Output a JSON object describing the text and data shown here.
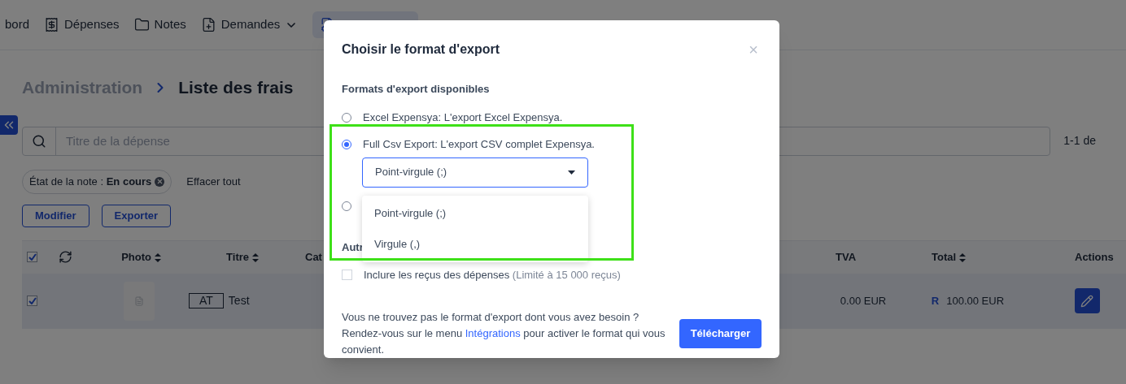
{
  "nav": {
    "items": [
      {
        "label": "bord",
        "kind": "plain",
        "selected": false
      },
      {
        "label": "Dépenses",
        "kind": "expenses",
        "selected": false
      },
      {
        "label": "Notes",
        "kind": "reports",
        "selected": false
      },
      {
        "label": "Demandes",
        "kind": "requests",
        "selected": false,
        "dropdown": true
      },
      {
        "kind": "admin",
        "selected": true
      }
    ]
  },
  "breadcrumb": {
    "parent": "Administration",
    "current": "Liste des frais"
  },
  "search": {
    "placeholder": "Titre de la dépense"
  },
  "pagination": "1-1 de",
  "filters": [
    {
      "label": "État de la note : ",
      "value": "En cours"
    }
  ],
  "clear_all": "Effacer tout",
  "actions": [
    "Modifier",
    "Exporter"
  ],
  "table": {
    "header_checked": true,
    "columns": [
      "Photo",
      "Titre",
      "Cat",
      "TVA",
      "Total",
      "Actions"
    ],
    "rows": [
      {
        "checked": true,
        "selected": true,
        "tag": "AT",
        "title": "Test",
        "tva": "0.00 EUR",
        "total_mark": "R",
        "total": "100.00 EUR"
      }
    ]
  },
  "dialog": {
    "title": "Choisir le format d'export",
    "close": "×",
    "section": "Formats d'export disponibles",
    "formats": [
      {
        "label": "Excel Expensya: L'export Excel Expensya.",
        "selected": false
      },
      {
        "label": "Full Csv Export: L'export CSV complet Expensya.",
        "selected": true,
        "separator": {
          "value": "Point-virgule (;)",
          "expanded": true,
          "options": [
            "Point-virgule (;)",
            "Virgule (,)"
          ]
        }
      },
      {
        "selected": false
      }
    ],
    "other_section": "Autr",
    "include_receipts": {
      "label": "Inclure les reçus des dépenses",
      "note": "(Limité à 15 000 reçus)",
      "checked": false
    },
    "help_before": "Vous ne trouvez pas le format d'export dont vous avez besoin ? Rendez-vous sur le menu ",
    "help_link": "Intégrations",
    "help_after": " pour activer le format qui vous convient.",
    "submit": "Télécharger"
  }
}
